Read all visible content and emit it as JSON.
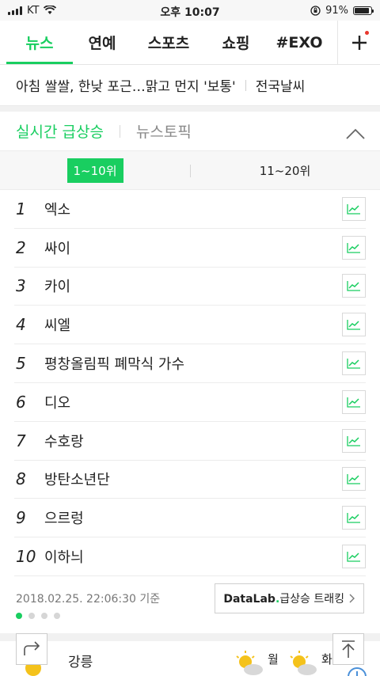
{
  "status": {
    "carrier": "KT",
    "time": "오후 10:07",
    "battery": "91%",
    "battery_level": 0.91
  },
  "tabs": [
    {
      "label": "뉴스",
      "active": true
    },
    {
      "label": "연예"
    },
    {
      "label": "스포츠"
    },
    {
      "label": "쇼핑"
    },
    {
      "label": "#EXO"
    }
  ],
  "headline": {
    "text": "아침 쌀쌀, 한낮 포근…맑고 먼지 '보통'",
    "link": "전국날씨"
  },
  "ranking": {
    "tab_realtime": "실시간 급상승",
    "tab_news_topic": "뉴스토픽",
    "range_1": "1~10위",
    "range_2": "11~20위",
    "items": [
      {
        "rank": "1",
        "keyword": "엑소"
      },
      {
        "rank": "2",
        "keyword": "싸이"
      },
      {
        "rank": "3",
        "keyword": "카이"
      },
      {
        "rank": "4",
        "keyword": "씨엘"
      },
      {
        "rank": "5",
        "keyword": "평창올림픽 폐막식 가수"
      },
      {
        "rank": "6",
        "keyword": "디오"
      },
      {
        "rank": "7",
        "keyword": "수호랑"
      },
      {
        "rank": "8",
        "keyword": "방탄소년단"
      },
      {
        "rank": "9",
        "keyword": "으르렁"
      },
      {
        "rank": "10",
        "keyword": "이하늬"
      }
    ],
    "timestamp": "2018.02.25. 22:06:30 기준",
    "datalab_brand": "DataLab",
    "datalab_dot": ".",
    "datalab_label": "급상승 트래킹",
    "pager": {
      "count": 4,
      "active": 1
    }
  },
  "weather": {
    "city": "강릉",
    "day1": "월",
    "day2": "화"
  },
  "colors": {
    "accent": "#19ce60",
    "badge": "#e8372d"
  }
}
